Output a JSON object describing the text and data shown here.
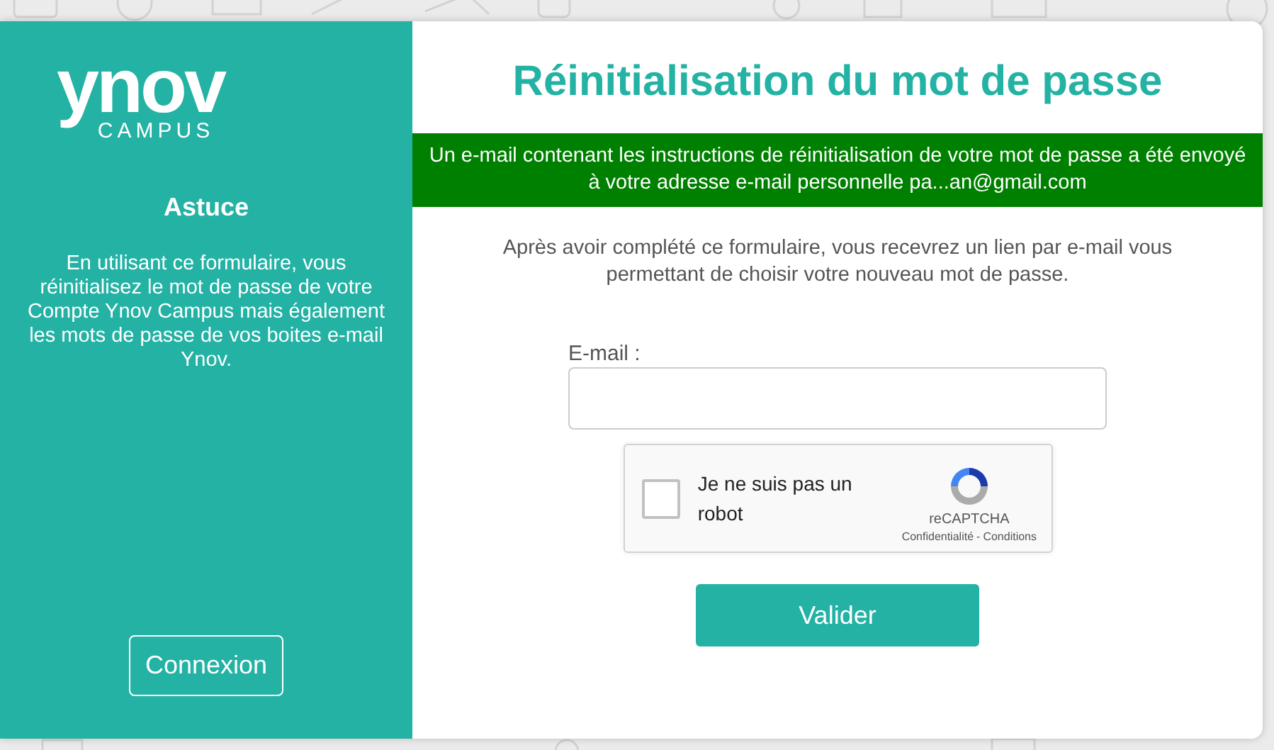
{
  "sidebar": {
    "logo": {
      "word": "ynov",
      "sub": "CAMPUS"
    },
    "tip_title": "Astuce",
    "tip_text": "En utilisant ce formulaire, vous réinitialisez le mot de passe de votre Compte Ynov Campus mais également les mots de passe de vos boites e-mail Ynov.",
    "login_button": "Connexion"
  },
  "main": {
    "title": "Réinitialisation du mot de passe",
    "success_banner": "Un e-mail contenant les instructions de réinitialisation de votre mot de passe a été envoyé à votre adresse e-mail personnelle pa...an@gmail.com",
    "intro": "Après avoir complété ce formulaire, vous recevrez un lien par e-mail vous permettant de choisir votre nouveau mot de passe.",
    "email_label": "E-mail :",
    "captcha": {
      "label": "Je ne suis pas un robot",
      "checked": false,
      "brand": "reCAPTCHA",
      "privacy": "Confidentialité",
      "separator": "-",
      "terms": "Conditions"
    },
    "submit_button": "Valider"
  }
}
